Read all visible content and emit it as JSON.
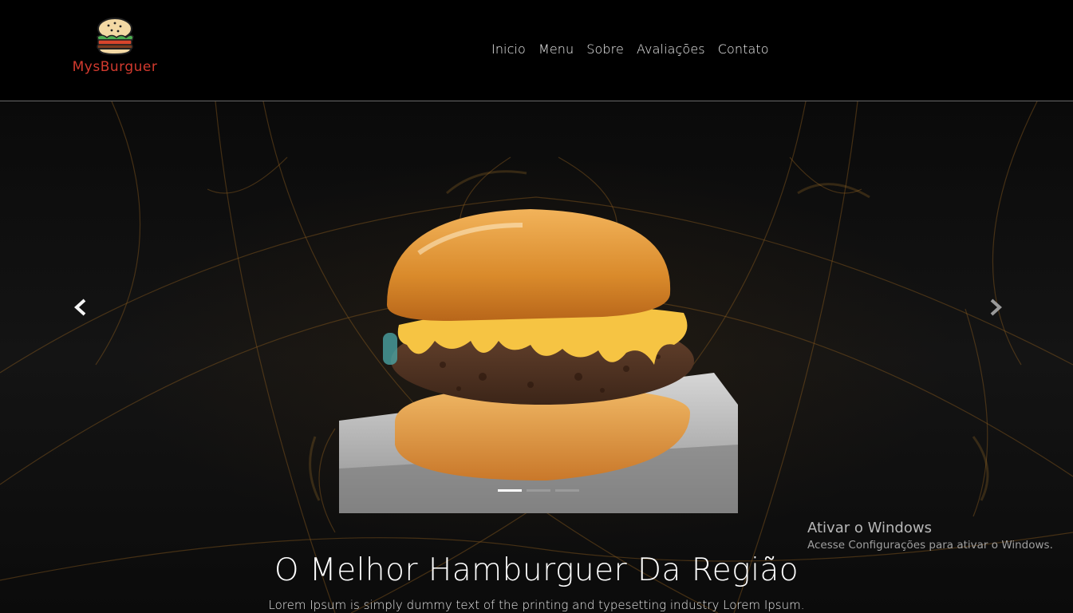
{
  "brand": {
    "name": "MysBurguer",
    "logo_icon": "burger-icon",
    "name_color": "#d23a2e"
  },
  "nav": {
    "items": [
      {
        "label": "Inicio"
      },
      {
        "label": "Menu"
      },
      {
        "label": "Sobre"
      },
      {
        "label": "Avaliações"
      },
      {
        "label": "Contato"
      }
    ]
  },
  "carousel": {
    "prev_icon": "chevron-left-icon",
    "next_icon": "chevron-right-icon",
    "slide_image": "burger-photo",
    "slide_count": 3,
    "active_index": 0
  },
  "hero": {
    "title": "O Melhor Hamburguer Da Região",
    "subtitle": "Lorem Ipsum is simply dummy text of the printing and typesetting industry Lorem Ipsum."
  },
  "os_watermark": {
    "line1": "Ativar o Windows",
    "line2": "Acesse Configurações para ativar o Windows."
  },
  "colors": {
    "background": "#000000",
    "accent_gold": "#c8953a"
  }
}
